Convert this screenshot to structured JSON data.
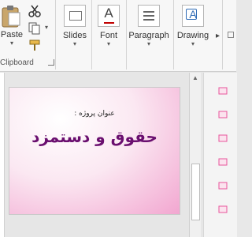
{
  "ribbon": {
    "clipboard": {
      "paste_label": "Paste",
      "group_label": "Clipboard"
    },
    "slides_label": "Slides",
    "font_label": "Font",
    "paragraph_label": "Paragraph",
    "drawing_label": "Drawing"
  },
  "slide": {
    "subtitle": "عنوان پروژه :",
    "title": "حقوق و دستمزد"
  },
  "colors": {
    "title": "#6a0f6f",
    "accent": "#e8569c",
    "font_icon_underline": "#c00000"
  }
}
